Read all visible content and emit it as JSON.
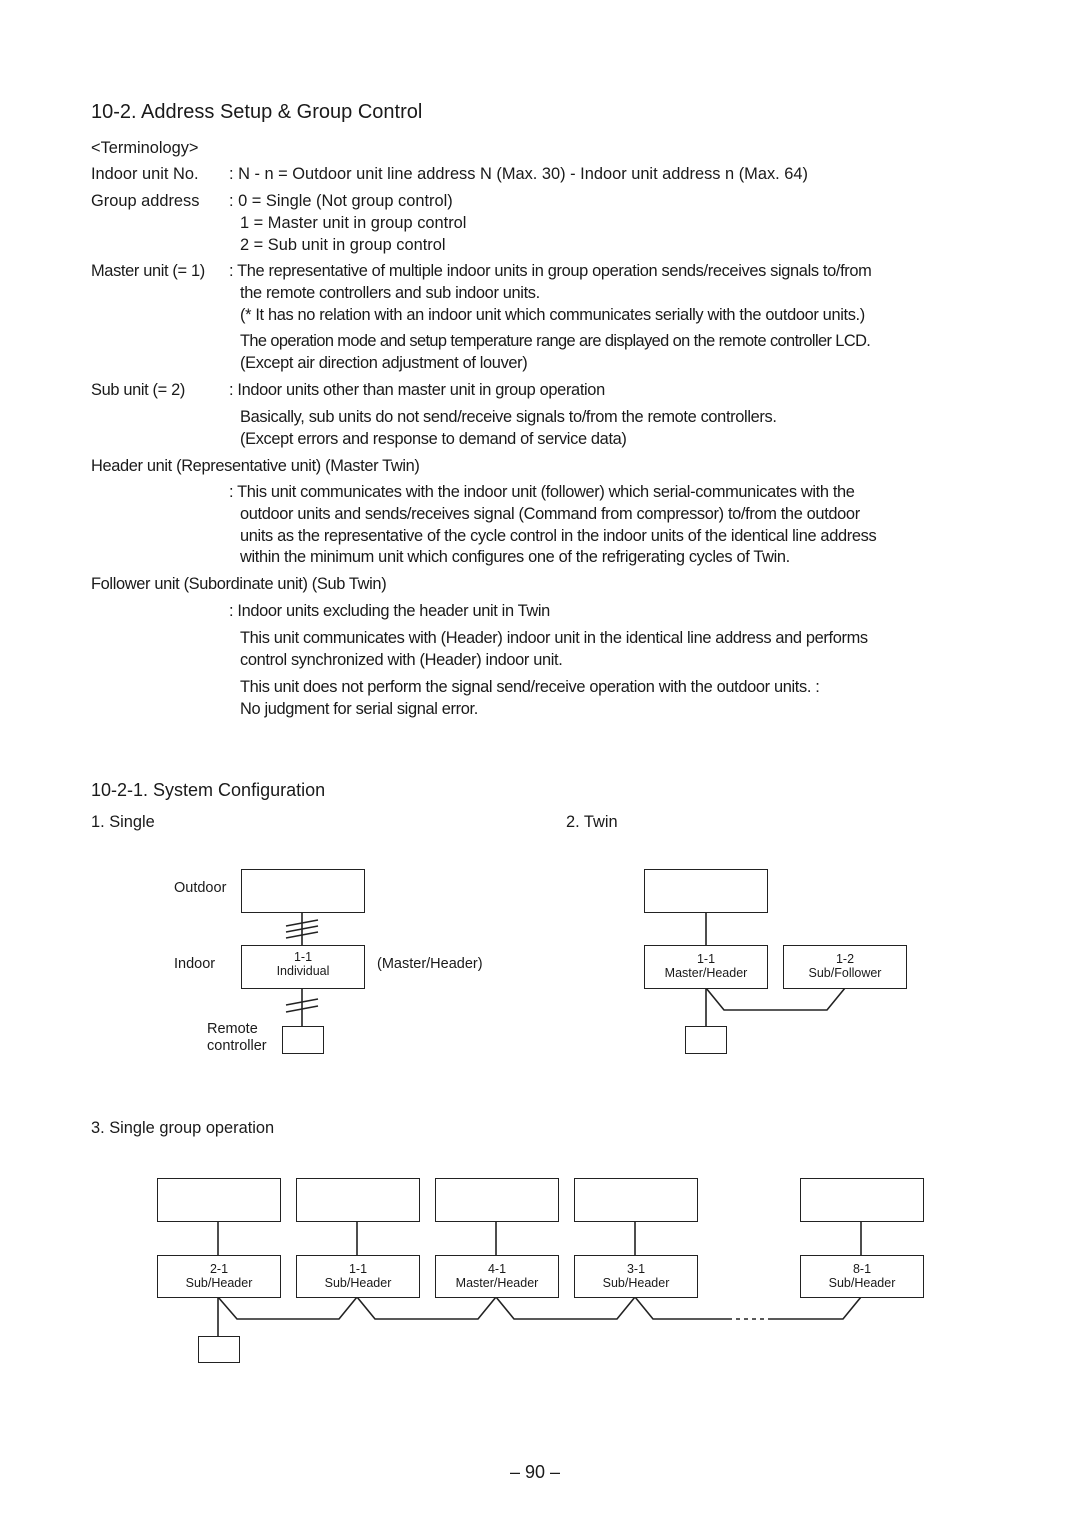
{
  "section": {
    "title": "10-2.  Address Setup & Group Control",
    "terminology_heading": "<Terminology>",
    "terms": [
      {
        "term": "Indoor unit No.",
        "lines": [
          ": N - n = Outdoor unit line address N (Max. 30) - Indoor unit address n (Max. 64)"
        ]
      },
      {
        "term": "Group address",
        "lines": [
          ": 0 = Single (Not group control)",
          "1 = Master unit in group control",
          "2 = Sub unit in group control"
        ]
      },
      {
        "term": "Master unit (= 1)",
        "lines": [
          ": The representative of multiple indoor units in group operation sends/receives signals to/from",
          "the remote controllers and sub indoor units.",
          "(* It has no relation with an indoor unit which communicates serially with the outdoor units.)",
          "The operation mode and setup temperature range are displayed on the remote controller LCD.",
          "(Except air direction adjustment of louver)"
        ]
      },
      {
        "term": "Sub unit (= 2)",
        "lines": [
          ": Indoor units other than master unit in group operation",
          "Basically, sub units do not send/receive signals to/from the remote controllers.",
          "(Except errors and response to demand of service data)"
        ]
      },
      {
        "term": "Header unit (Representative unit) (Master Twin)",
        "lines": [
          ": This unit communicates with the indoor unit (follower) which serial-communicates with the",
          "outdoor units and sends/receives signal (Command from compressor) to/from the outdoor",
          "units as the representative of the cycle control in the indoor units of the identical line address",
          "within the minimum unit which configures one of the refrigerating cycles of Twin."
        ]
      },
      {
        "term": "Follower unit (Subordinate unit) (Sub Twin)",
        "lines": [
          ": Indoor units excluding the header unit in Twin",
          "This unit communicates with (Header) indoor unit in the identical line address and performs",
          "control synchronized with (Header) indoor unit.",
          "This unit does not perform the signal send/receive operation with the outdoor units. :",
          "No judgment for serial signal error."
        ]
      }
    ]
  },
  "subsection": {
    "title": "10-2-1.  System Configuration",
    "single": {
      "heading": "1.  Single",
      "outdoor_label": "Outdoor",
      "indoor_label": "Indoor",
      "remote_label_1": "Remote",
      "remote_label_2": "controller",
      "unit_address": "1-1",
      "unit_role": "Individual",
      "note": "(Master/Header)"
    },
    "twin": {
      "heading": "2.  Twin",
      "units": [
        {
          "address": "1-1",
          "role": "Master/Header"
        },
        {
          "address": "1-2",
          "role": "Sub/Follower"
        }
      ]
    },
    "group": {
      "heading": "3.  Single group operation",
      "units": [
        {
          "address": "2-1",
          "role": "Sub/Header"
        },
        {
          "address": "1-1",
          "role": "Sub/Header"
        },
        {
          "address": "4-1",
          "role": "Master/Header"
        },
        {
          "address": "3-1",
          "role": "Sub/Header"
        },
        {
          "address": "8-1",
          "role": "Sub/Header"
        }
      ]
    }
  },
  "page_number": "– 90 –"
}
